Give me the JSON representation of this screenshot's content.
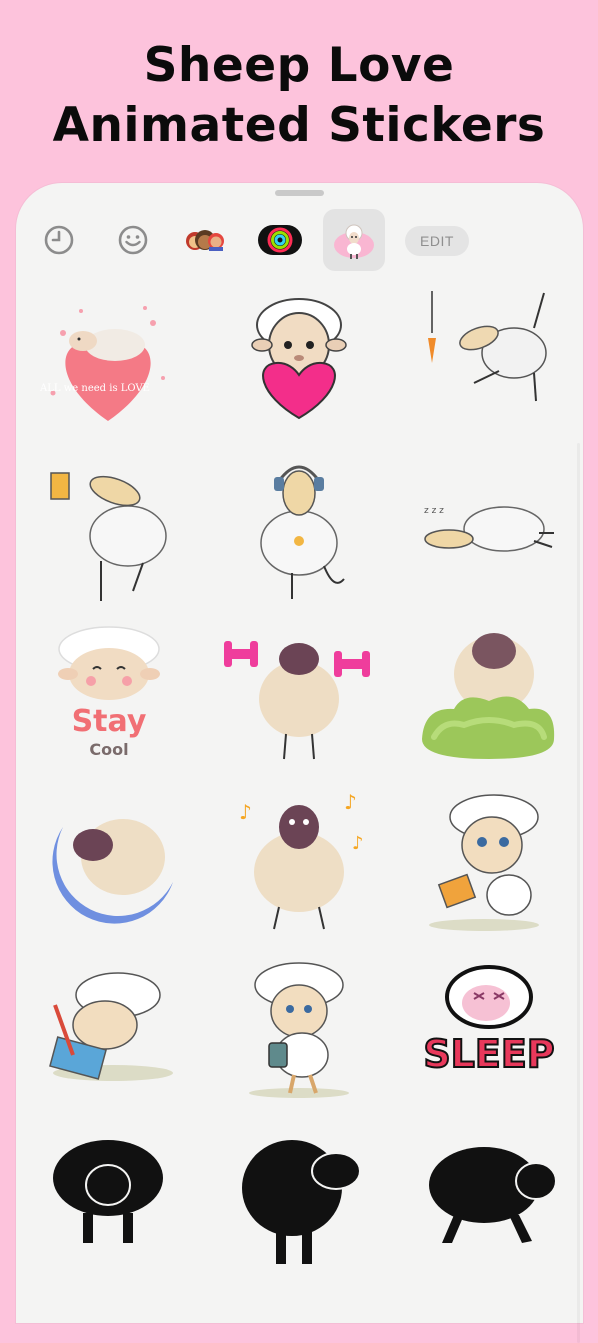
{
  "header": {
    "line1": "Sheep Love",
    "line2": "Animated Stickers"
  },
  "tabs": [
    {
      "icon": "recents-clock-icon"
    },
    {
      "icon": "emoji-smiley-icon"
    },
    {
      "icon": "memoji-pack-icon"
    },
    {
      "icon": "activity-rings-icon"
    },
    {
      "icon": "sheep-pack-icon",
      "selected": true
    }
  ],
  "edit_label": "EDIT",
  "stickers": {
    "heart_text": "ALL we need is LOVE",
    "stay": "Stay",
    "cool": "Cool",
    "sleep": "SLEEP"
  },
  "colors": {
    "background": "#fdc3dc",
    "panel": "#f4f4f3",
    "selected_tab": "#e3e3e3"
  }
}
